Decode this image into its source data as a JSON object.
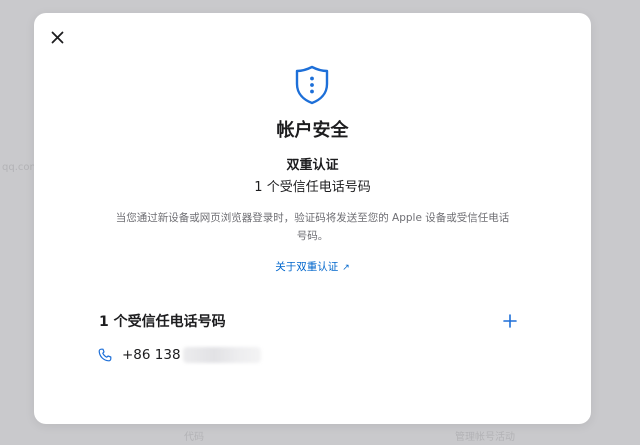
{
  "modal": {
    "title": "帐户安全",
    "subtitle": "双重认证",
    "trusted_count_line": "1 个受信任电话号码",
    "description": "当您通过新设备或网页浏览器登录时，验证码将发送至您的 Apple 设备或受信任电话号码。",
    "learn_more_link": "关于双重认证",
    "section_title": "1 个受信任电话号码",
    "phone_number_visible": "+86 138"
  },
  "background": {
    "ghost_text_left": "qq.com",
    "ghost_text_bottom_left": "代码",
    "ghost_text_bottom_right": "管理帐号活动"
  },
  "colors": {
    "accent": "#0066cc",
    "icon_blue": "#1d6fd8",
    "text_primary": "#1d1d1f",
    "text_secondary": "#6e6e73"
  },
  "icons": {
    "close": "close-icon",
    "shield": "shield-icon",
    "add": "plus-icon",
    "phone": "phone-icon",
    "external": "arrow-up-right-icon"
  }
}
